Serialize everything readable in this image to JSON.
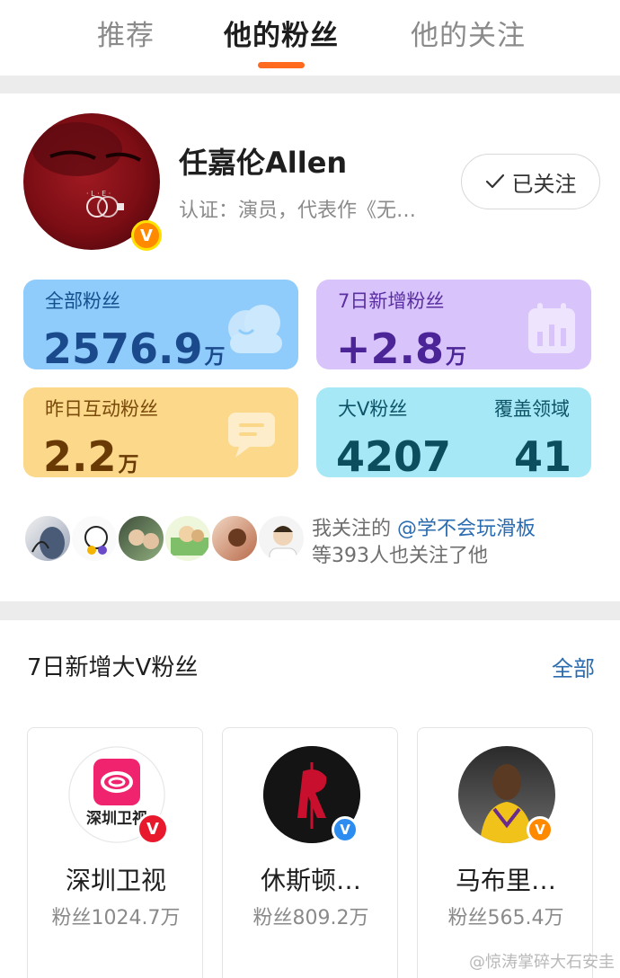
{
  "tabs": [
    {
      "label": "推荐"
    },
    {
      "label": "他的粉丝"
    },
    {
      "label": "他的关注"
    }
  ],
  "profile": {
    "name": "任嘉伦Allen",
    "verification": "认证：演员，代表作《无…",
    "follow_button": "已关注",
    "badge": "V"
  },
  "stats": {
    "total_fans": {
      "label": "全部粉丝",
      "value": "2576.9",
      "unit": "万"
    },
    "new_7d": {
      "label": "7日新增粉丝",
      "value": "+2.8",
      "unit": "万"
    },
    "interactive_yesterday": {
      "label": "昨日互动粉丝",
      "value": "2.2",
      "unit": "万"
    },
    "big_v": {
      "label": "大V粉丝",
      "value": "4207",
      "domain_label": "覆盖领域",
      "domain_value": "41"
    }
  },
  "mutual": {
    "line1_prefix": "我关注的",
    "mention": "@学不会玩滑板",
    "line2": "等393人也关注了他"
  },
  "section": {
    "title": "7日新增大V粉丝",
    "all_link": "全部"
  },
  "big_v_fans": [
    {
      "name": "深圳卫视",
      "fans": "粉丝1024.7万",
      "logo_text": "深圳卫视",
      "badge": "V"
    },
    {
      "name": "休斯顿…",
      "fans": "粉丝809.2万",
      "badge": "V"
    },
    {
      "name": "马布里…",
      "fans": "粉丝565.4万",
      "badge": "V"
    }
  ],
  "watermark": "@惊涛掌碎大石安圭",
  "colors": {
    "accent": "#ff6a1e",
    "link": "#2b6cb0",
    "card_total": "#8fccfb",
    "card_new": "#d9c3fb",
    "card_interact": "#fbd88a",
    "card_bigv": "#a6e8f5"
  }
}
